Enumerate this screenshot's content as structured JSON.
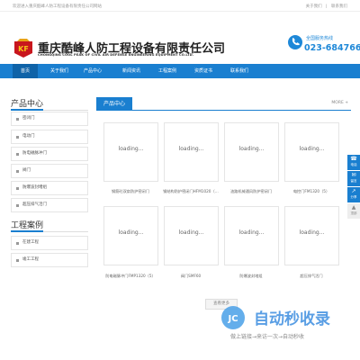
{
  "topbar": {
    "welcome": "欢迎进入重庆酷峰人防工程设备有限责任公司网站",
    "links": [
      "关于我们",
      "联系我们"
    ],
    "sep": "|"
  },
  "header": {
    "company_name": "重庆酷峰人防工程设备有限责任公司",
    "english_name": "CHONGQING COOL PEAK OF CIVIL AIR DEFENSE ENGINEERING EQUIPMENT CO.LTD.",
    "logo_text": "KF",
    "logo_color": "#c8161d",
    "hotline_label": "全国服务热线",
    "hotline_number": "023-68476646",
    "accent": "#1a7fd0"
  },
  "nav": [
    {
      "label": "首页",
      "active": true
    },
    {
      "label": "关于我们",
      "active": false
    },
    {
      "label": "产品中心",
      "active": false
    },
    {
      "label": "新闻资讯",
      "active": false
    },
    {
      "label": "工程案例",
      "active": false
    },
    {
      "label": "资质证书",
      "active": false
    },
    {
      "label": "联系我们",
      "active": false
    }
  ],
  "sidebar": {
    "products_title": "产品中心",
    "products": [
      "密闭门",
      "电动门",
      "防电磁脉冲门",
      "阀门",
      "防爆波封堵组",
      "超压排气活门"
    ],
    "cases_title": "工程案例",
    "cases": [
      "在建工程",
      "竣工工程"
    ]
  },
  "main": {
    "tab": "产品中心",
    "more": "MORE +",
    "placeholder": "loading...",
    "products": [
      "钢筋砼双扇防护密闭门",
      "钢结构防护密闭门HFM1020（…",
      "油路机械通风防护密闭门",
      "电控门FM1320（5）",
      "防电磁脉冲门FMP1320（5）",
      "阀门SMF60",
      "防爆波封堵组",
      "超压排气活门"
    ],
    "more_button": "查看更多"
  },
  "side_buttons": [
    {
      "icon": "☎",
      "label": "电话",
      "icon_name": "phone-icon"
    },
    {
      "icon": "✉",
      "label": "留言",
      "icon_name": "message-icon"
    },
    {
      "icon": "↗",
      "label": "分享",
      "icon_name": "share-icon"
    },
    {
      "icon": "▲",
      "label": "顶部",
      "icon_name": "arrow-up-icon"
    }
  ],
  "watermark": {
    "logo_text": "JC",
    "title": "自动秒收录",
    "subtitle": "做上链接→来访一次→自动秒收"
  }
}
